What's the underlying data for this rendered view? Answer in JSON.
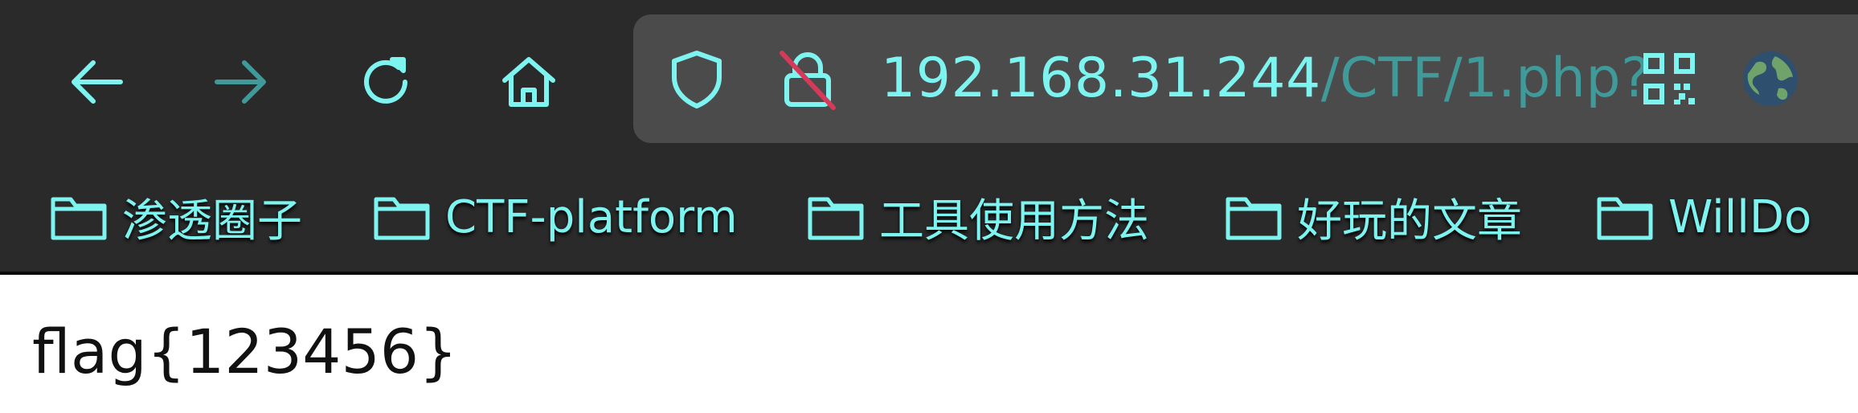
{
  "toolbar": {
    "back_icon": "back-arrow-icon",
    "forward_icon": "forward-arrow-icon",
    "reload_icon": "reload-icon",
    "home_icon": "home-icon"
  },
  "urlbar": {
    "host": "192.168.31.244",
    "path": "/CTF/1.php?",
    "icons": [
      "shield-icon",
      "insecure-lock-icon",
      "qr-code-icon",
      "globe-icon"
    ]
  },
  "bookmarks": [
    {
      "label": "渗透圈子"
    },
    {
      "label": "CTF-platform"
    },
    {
      "label": "工具使用方法"
    },
    {
      "label": "好玩的文章"
    },
    {
      "label": "WillDo"
    }
  ],
  "page": {
    "content": "flag{123456}"
  },
  "colors": {
    "accent": "#7ef4f0",
    "chrome_bg": "#2a2a2a",
    "urlbar_bg": "#4b4b4b",
    "dim_path": "#3f9a99"
  }
}
